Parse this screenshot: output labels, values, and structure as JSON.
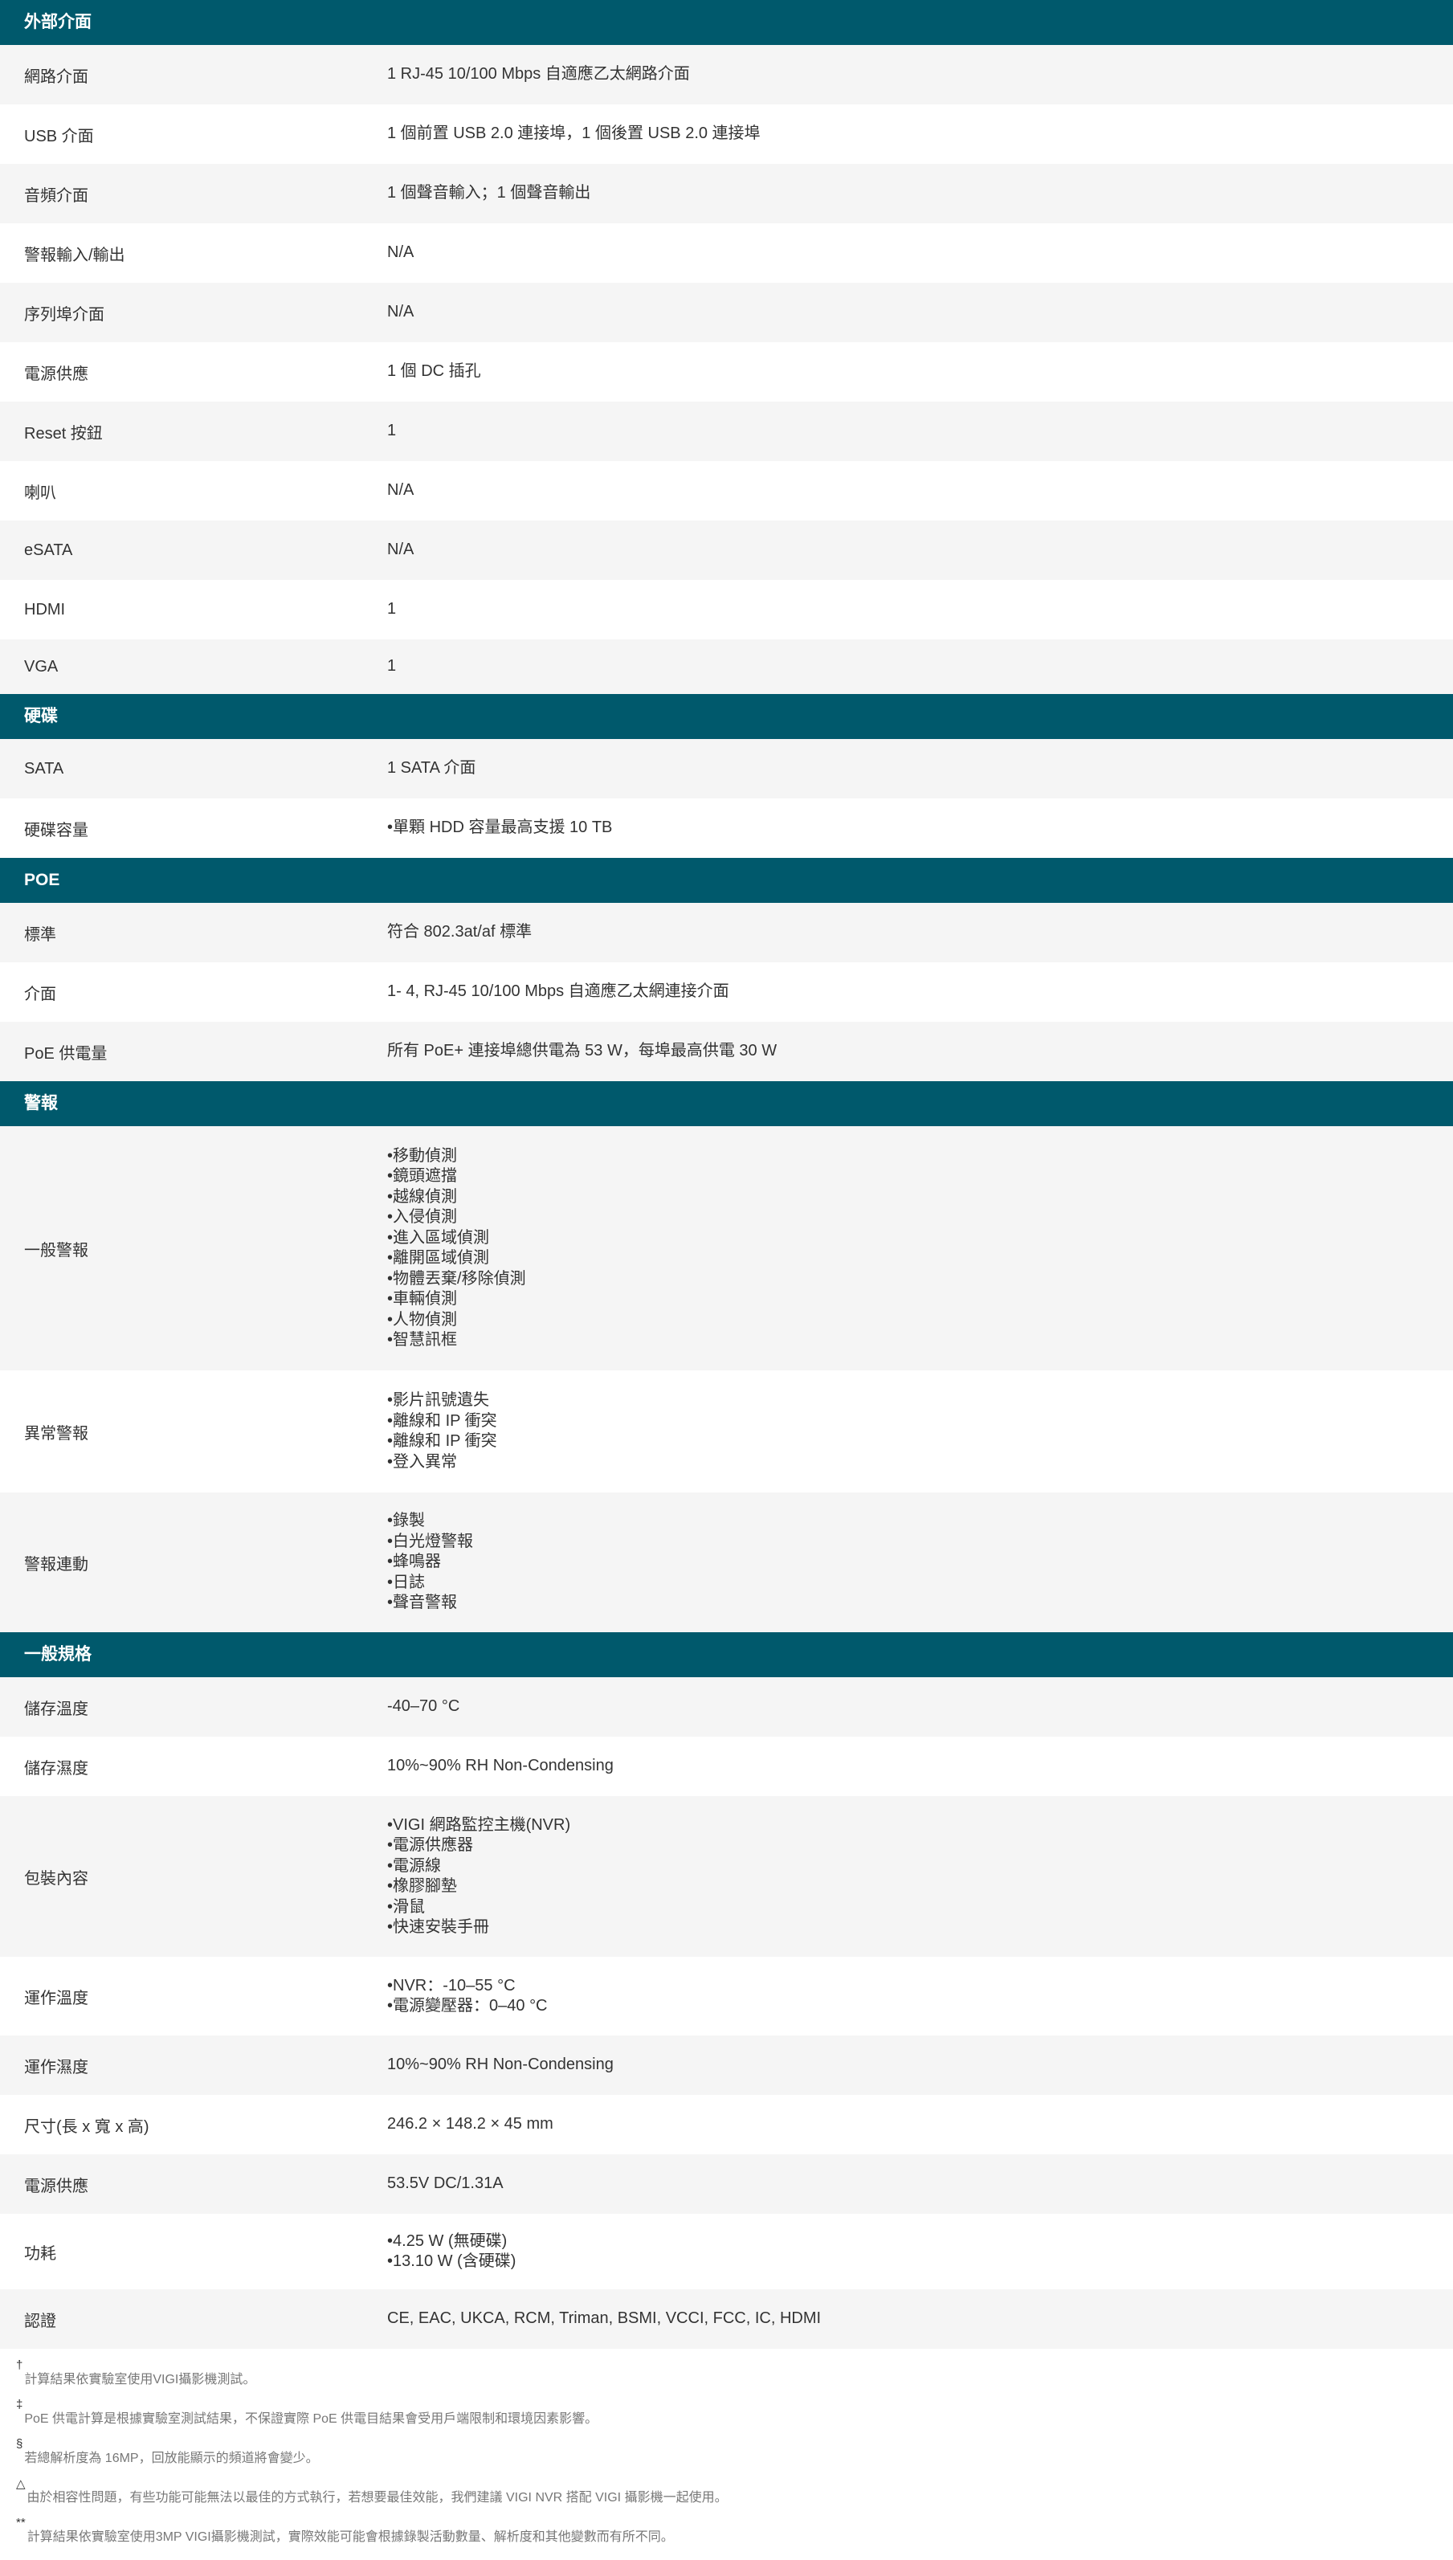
{
  "sections": [
    {
      "title": "外部介面",
      "rows": [
        {
          "label": "網路介面",
          "value": "1 RJ-45 10/100 Mbps 自適應乙太網路介面"
        },
        {
          "label": "USB 介面",
          "value": "1 個前置 USB 2.0 連接埠，1 個後置 USB 2.0 連接埠"
        },
        {
          "label": "音頻介面",
          "value": "1 個聲音輸入；1 個聲音輸出"
        },
        {
          "label": "警報輸入/輸出",
          "value": "N/A"
        },
        {
          "label": "序列埠介面",
          "value": "N/A"
        },
        {
          "label": "電源供應",
          "value": "1 個 DC 插孔"
        },
        {
          "label": "Reset 按鈕",
          "value": "1"
        },
        {
          "label": "喇叭",
          "value": "N/A"
        },
        {
          "label": "eSATA",
          "value": "N/A"
        },
        {
          "label": "HDMI",
          "value": "1"
        },
        {
          "label": "VGA",
          "value": "1"
        }
      ]
    },
    {
      "title": "硬碟",
      "rows": [
        {
          "label": "SATA",
          "value": "1 SATA 介面"
        },
        {
          "label": "硬碟容量",
          "list": [
            "單顆 HDD 容量最高支援 10 TB"
          ]
        }
      ]
    },
    {
      "title": "POE",
      "rows": [
        {
          "label": "標準",
          "value": "符合 802.3at/af 標準"
        },
        {
          "label": "介面",
          "value": "1- 4, RJ-45 10/100 Mbps 自適應乙太網連接介面"
        },
        {
          "label": "PoE 供電量",
          "value": "所有 PoE+ 連接埠總供電為 53 W，每埠最高供電 30 W"
        }
      ]
    },
    {
      "title": "警報",
      "rows": [
        {
          "label": "一般警報",
          "list": [
            "移動偵測",
            "鏡頭遮擋",
            "越線偵測",
            "入侵偵測",
            "進入區域偵測",
            "離開區域偵測",
            "物體丟棄/移除偵測",
            "車輛偵測",
            "人物偵測",
            "智慧訊框"
          ]
        },
        {
          "label": "異常警報",
          "list": [
            "影片訊號遺失",
            "離線和 IP 衝突",
            "離線和 IP 衝突",
            "登入異常"
          ]
        },
        {
          "label": "警報連動",
          "list": [
            "錄製",
            "白光燈警報",
            "蜂鳴器",
            "日誌",
            "聲音警報"
          ]
        }
      ]
    },
    {
      "title": "一般規格",
      "rows": [
        {
          "label": "儲存溫度",
          "value": "-40–70 °C"
        },
        {
          "label": "儲存濕度",
          "value": "10%~90% RH Non-Condensing"
        },
        {
          "label": "包裝內容",
          "list": [
            "VIGI 網路監控主機(NVR)",
            "電源供應器",
            "電源線",
            "橡膠腳墊",
            "滑鼠",
            "快速安裝手冊"
          ]
        },
        {
          "label": "運作溫度",
          "list": [
            "NVR：-10–55 °C",
            "電源變壓器：0–40 °C"
          ]
        },
        {
          "label": "運作濕度",
          "value": "10%~90% RH Non-Condensing"
        },
        {
          "label": "尺寸(長 x 寬 x 高)",
          "value": "246.2 × 148.2 × 45 mm"
        },
        {
          "label": "電源供應",
          "value": "53.5V DC/1.31A"
        },
        {
          "label": "功耗",
          "list": [
            "4.25 W (無硬碟)",
            "13.10 W (含硬碟)"
          ]
        },
        {
          "label": "認證",
          "value": "CE, EAC, UKCA, RCM, Triman, BSMI, VCCI, FCC, IC, HDMI"
        }
      ]
    }
  ],
  "footnotes": [
    {
      "mark": "†",
      "text": "計算結果依實驗室使用VIGI攝影機測試。"
    },
    {
      "mark": "‡",
      "text": "PoE 供電計算是根據實驗室測試結果，不保證實際 PoE 供電目結果會受用戶端限制和環境因素影響。"
    },
    {
      "mark": "§",
      "text": "若總解析度為 16MP，回放能顯示的頻道將會變少。"
    },
    {
      "mark": "△",
      "text": "由於相容性問題，有些功能可能無法以最佳的方式執行，若想要最佳效能，我們建議 VIGI NVR 搭配 VIGI 攝影機一起使用。"
    },
    {
      "mark": "**",
      "text": "計算結果依實驗室使用3MP VIGI攝影機測試，實際效能可能會根據錄製活動數量、解析度和其他變數而有所不同。"
    }
  ]
}
